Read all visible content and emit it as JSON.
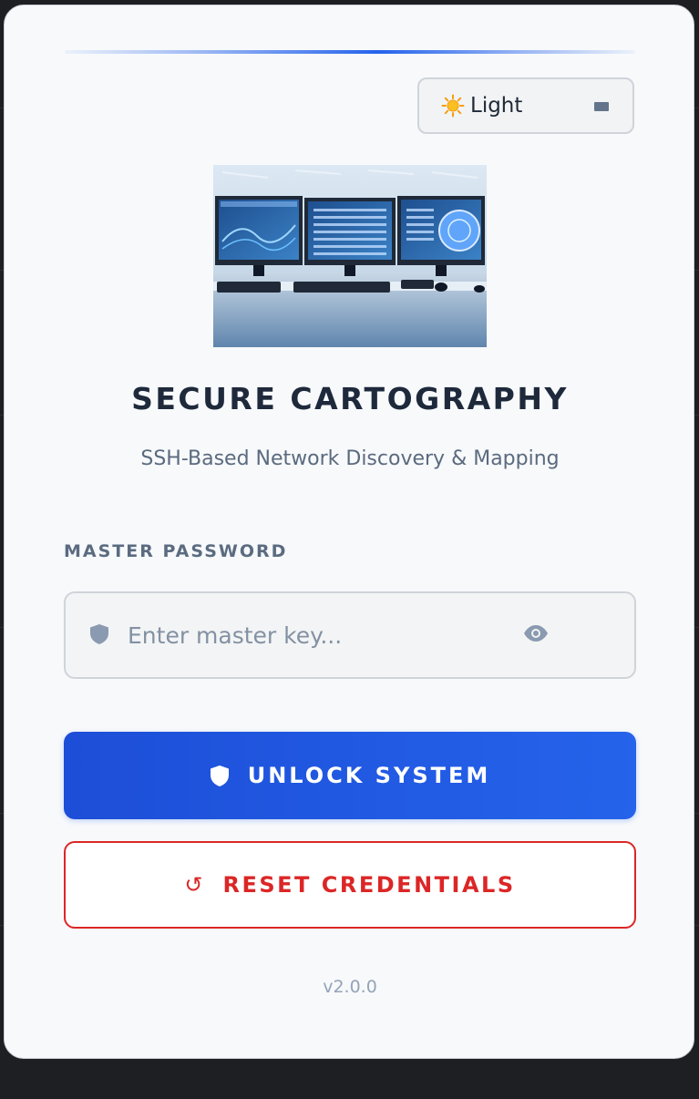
{
  "theme_toggle": {
    "icon": "sun-icon",
    "label": "Light"
  },
  "hero": {
    "icon": "network-monitors-image"
  },
  "header": {
    "title": "SECURE CARTOGRAPHY",
    "subtitle": "SSH-Based Network Discovery & Mapping"
  },
  "password": {
    "label": "MASTER PASSWORD",
    "placeholder": "Enter master key...",
    "value": "",
    "leading_icon": "shield-icon",
    "trailing_icon": "eye-icon"
  },
  "actions": {
    "unlock_label": "UNLOCK SYSTEM",
    "unlock_icon": "shield-icon",
    "reset_label": "RESET CREDENTIALS",
    "reset_icon": "refresh-icon",
    "reset_glyph": "↺"
  },
  "footer": {
    "version": "v2.0.0"
  },
  "colors": {
    "accent": "#2563eb",
    "danger": "#dc2626",
    "card_bg": "#f7f9fb",
    "page_bg": "#1e1f22"
  }
}
